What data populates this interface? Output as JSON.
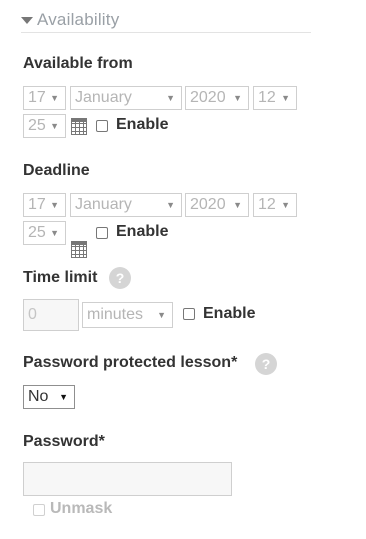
{
  "section": {
    "title": "Availability"
  },
  "available_from": {
    "label": "Available from",
    "day": "17",
    "month": "January",
    "year": "2020",
    "hour": "12",
    "minute": "25",
    "enable_label": "Enable"
  },
  "deadline": {
    "label": "Deadline",
    "day": "17",
    "month": "January",
    "year": "2020",
    "hour": "12",
    "minute": "25",
    "enable_label": "Enable"
  },
  "time_limit": {
    "label": "Time limit",
    "help": "?",
    "value": "0",
    "unit": "minutes",
    "enable_label": "Enable"
  },
  "password_protected": {
    "label": "Password protected lesson",
    "required_mark": "*",
    "help": "?",
    "value": "No"
  },
  "password": {
    "label": "Password",
    "required_mark": "*",
    "value": "",
    "unmask_label": "Unmask"
  },
  "icons": {
    "caret": "caret-down-icon",
    "calendar": "calendar-icon",
    "help": "help-icon",
    "dropdown": "chevron-down-icon"
  }
}
